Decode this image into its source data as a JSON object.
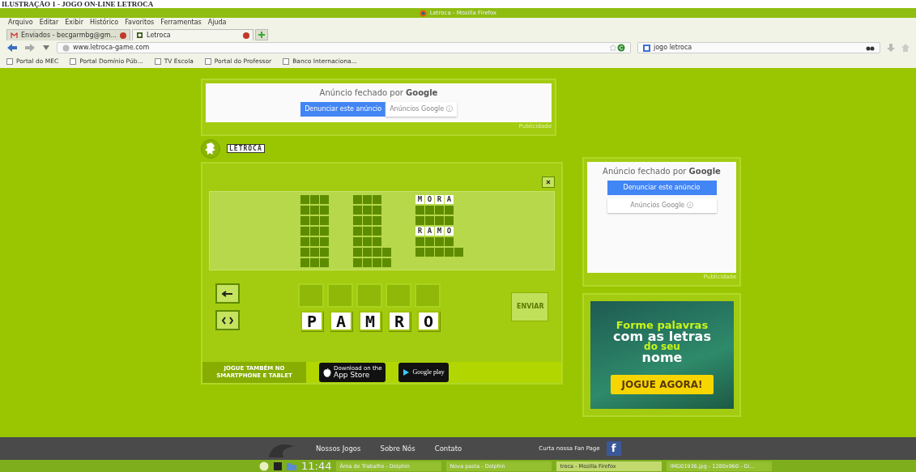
{
  "caption": "ILUSTRAÇÃO 1 - JOGO ON-LINE LETROCA",
  "browser": {
    "title": "Letroca - Mozilla Firefox",
    "menu": [
      "Arquivo",
      "Editar",
      "Exibir",
      "Histórico",
      "Favoritos",
      "Ferramentas",
      "Ajuda"
    ],
    "tabs": [
      {
        "label": "Enviados - becgarmbg@gm...",
        "selected": false
      },
      {
        "label": "Letroca",
        "selected": true
      }
    ],
    "address": "www.letroca-game.com",
    "search": "jogo letroca",
    "bookmarks": [
      "Portal do MEC",
      "Portal Domínio Púb...",
      "TV Escola",
      "Portal do Professor",
      "Banco Internaciona..."
    ]
  },
  "top_ad": {
    "title": "Anúncio fechado por",
    "brand": "Google",
    "report_button": "Denunciar este anúncio",
    "ads_button": "Anúncios Google ⓘ",
    "label": "Publicidade"
  },
  "logo": "LETROCA",
  "game": {
    "board": [
      [
        [
          {
            "hidden": true
          },
          {
            "hidden": true
          },
          {
            "hidden": true
          }
        ],
        [
          {
            "hidden": true
          },
          {
            "hidden": true
          },
          {
            "hidden": true
          }
        ],
        [
          {
            "hidden": true
          },
          {
            "hidden": true
          },
          {
            "hidden": true
          }
        ],
        [
          {
            "hidden": true
          },
          {
            "hidden": true
          },
          {
            "hidden": true
          }
        ],
        [
          {
            "hidden": true
          },
          {
            "hidden": true
          },
          {
            "hidden": true
          }
        ],
        [
          {
            "hidden": true
          },
          {
            "hidden": true
          },
          {
            "hidden": true
          }
        ],
        [
          {
            "hidden": true
          },
          {
            "hidden": true
          },
          {
            "hidden": true
          }
        ]
      ],
      [
        [
          {
            "hidden": true
          },
          {
            "hidden": true
          },
          {
            "hidden": true
          }
        ],
        [
          {
            "hidden": true
          },
          {
            "hidden": true
          },
          {
            "hidden": true
          }
        ],
        [
          {
            "hidden": true
          },
          {
            "hidden": true
          },
          {
            "hidden": true
          }
        ],
        [
          {
            "hidden": true
          },
          {
            "hidden": true
          },
          {
            "hidden": true
          }
        ],
        [
          {
            "hidden": true
          },
          {
            "hidden": true
          },
          {
            "hidden": true
          }
        ],
        [
          {
            "hidden": true
          },
          {
            "hidden": true
          },
          {
            "hidden": true
          },
          {
            "hidden": true
          }
        ],
        [
          {
            "hidden": true
          },
          {
            "hidden": true
          },
          {
            "hidden": true
          },
          {
            "hidden": true
          }
        ]
      ],
      [
        [
          {
            "hidden": false,
            "letter": "M"
          },
          {
            "hidden": false,
            "letter": "O"
          },
          {
            "hidden": false,
            "letter": "R"
          },
          {
            "hidden": false,
            "letter": "A"
          }
        ],
        [
          {
            "hidden": true
          },
          {
            "hidden": true
          },
          {
            "hidden": true
          },
          {
            "hidden": true
          }
        ],
        [
          {
            "hidden": true
          },
          {
            "hidden": true
          },
          {
            "hidden": true
          },
          {
            "hidden": true
          }
        ],
        [
          {
            "hidden": false,
            "letter": "R"
          },
          {
            "hidden": false,
            "letter": "A"
          },
          {
            "hidden": false,
            "letter": "M"
          },
          {
            "hidden": false,
            "letter": "O"
          }
        ],
        [
          {
            "hidden": true
          },
          {
            "hidden": true
          },
          {
            "hidden": true
          },
          {
            "hidden": true
          }
        ],
        [
          {
            "hidden": true
          },
          {
            "hidden": true
          },
          {
            "hidden": true
          },
          {
            "hidden": true
          },
          {
            "hidden": true
          }
        ]
      ]
    ],
    "answer_slots": [
      {
        "filled": false
      },
      {
        "filled": false
      },
      {
        "filled": false
      },
      {
        "filled": false
      },
      {
        "filled": false
      }
    ],
    "letters": [
      "P",
      "A",
      "M",
      "R",
      "O"
    ],
    "submit": "ENVIAR",
    "promo": [
      "JOGUE TAMBÉM NO",
      "SMARTPHONE E TABLET"
    ],
    "app_store": {
      "small": "Download on the",
      "big": "App Store"
    },
    "google_play": "Google play"
  },
  "side_ad": {
    "title": "Anúncio fechado por",
    "brand": "Google",
    "report_button": "Denunciar este anúncio",
    "ads_button": "Anúncios Google ⓘ",
    "label": "Publicidade"
  },
  "banner": {
    "lines": [
      "Forme palavras",
      "com as letras",
      "do seu",
      "nome"
    ],
    "button": "JOGUE AGORA!"
  },
  "footer": {
    "links": [
      "Nossos Jogos",
      "Sobre Nós",
      "Contato"
    ],
    "fan_page": "Curta nossa Fan Page",
    "fb": "f"
  },
  "taskbar": {
    "clock": "11:44",
    "tasks": [
      {
        "label": "Área de Trabalho - Dolphin",
        "selected": false
      },
      {
        "label": "Nova pasta - Dolphin",
        "selected": false
      },
      {
        "label": "troca - Mozilla Firefox",
        "selected": true
      },
      {
        "label": "IMG01936.jpg - 1280x960 - Gi...",
        "selected": false
      }
    ]
  }
}
